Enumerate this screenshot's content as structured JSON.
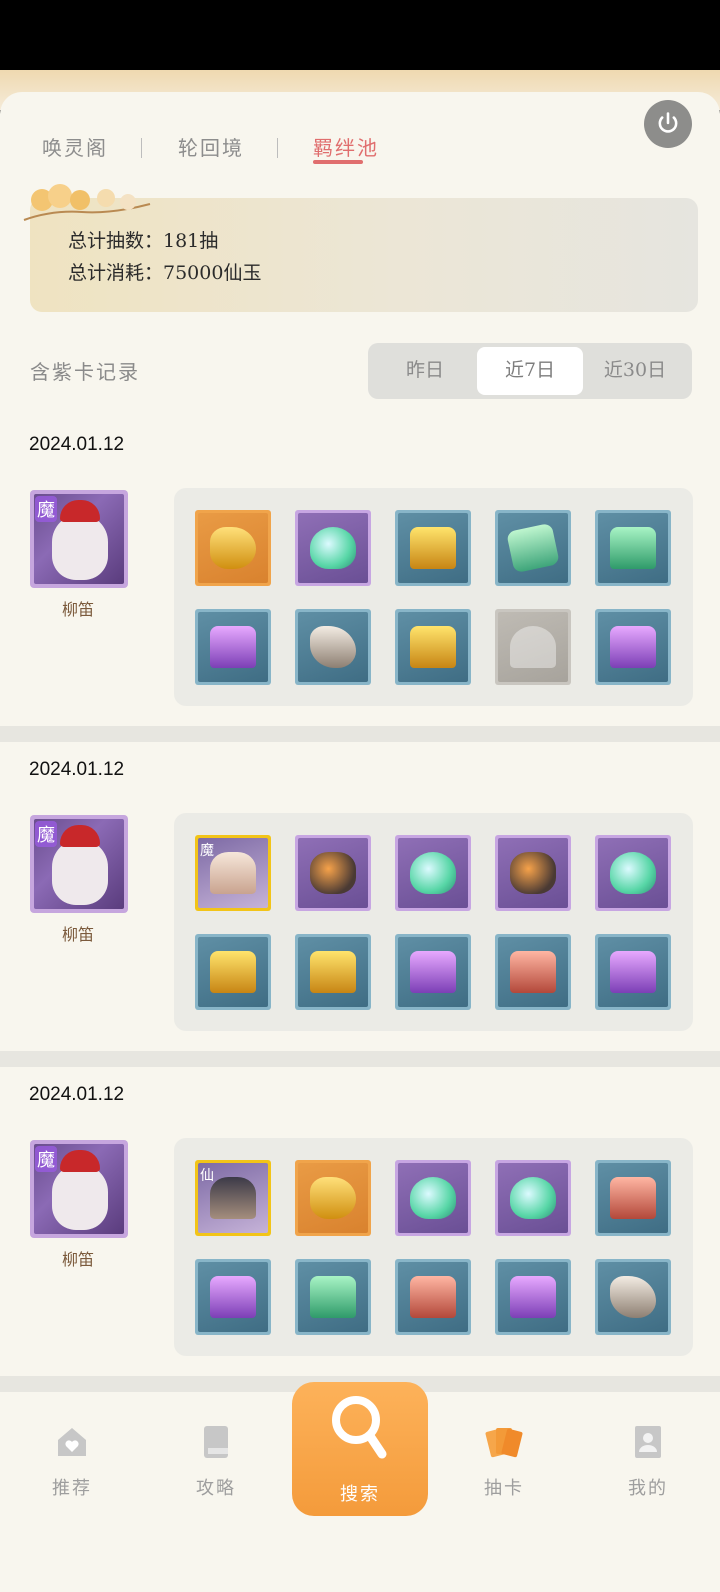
{
  "tabs": [
    {
      "label": "唤灵阁",
      "active": false
    },
    {
      "label": "轮回境",
      "active": false
    },
    {
      "label": "羁绊池",
      "active": true
    }
  ],
  "summary": {
    "total_draws": "总计抽数：181抽",
    "total_cost": "总计消耗：75000仙玉"
  },
  "records": {
    "title": "含紫卡记录",
    "ranges": [
      {
        "label": "昨日",
        "active": false
      },
      {
        "label": "近7日",
        "active": true
      },
      {
        "label": "近30日",
        "active": false
      }
    ]
  },
  "groups": [
    {
      "date": "2024.01.12",
      "character": {
        "name": "柳笛",
        "badge": "魔"
      },
      "items": [
        {
          "frame": "orange",
          "icon": "shard"
        },
        {
          "frame": "purple",
          "icon": "gem"
        },
        {
          "frame": "blue",
          "icon": "chest-gold"
        },
        {
          "frame": "blue",
          "icon": "leaf"
        },
        {
          "frame": "blue",
          "icon": "chest-green"
        },
        {
          "frame": "blue",
          "icon": "chest-purple"
        },
        {
          "frame": "blue",
          "icon": "stone"
        },
        {
          "frame": "blue",
          "icon": "chest-gold"
        },
        {
          "frame": "grey",
          "icon": "ghost"
        },
        {
          "frame": "blue",
          "icon": "chest-purple"
        }
      ]
    },
    {
      "date": "2024.01.12",
      "character": {
        "name": "柳笛",
        "badge": "魔"
      },
      "items": [
        {
          "frame": "char",
          "icon": "portrait",
          "badge": "魔"
        },
        {
          "frame": "purple",
          "icon": "ember"
        },
        {
          "frame": "purple",
          "icon": "gem"
        },
        {
          "frame": "purple",
          "icon": "ember"
        },
        {
          "frame": "purple",
          "icon": "gem"
        },
        {
          "frame": "blue",
          "icon": "chest-gold"
        },
        {
          "frame": "blue",
          "icon": "chest-gold"
        },
        {
          "frame": "blue",
          "icon": "chest-purple"
        },
        {
          "frame": "blue",
          "icon": "chest-red"
        },
        {
          "frame": "blue",
          "icon": "chest-purple"
        }
      ]
    },
    {
      "date": "2024.01.12",
      "character": {
        "name": "柳笛",
        "badge": "魔"
      },
      "items": [
        {
          "frame": "char",
          "icon": "portrait-dark",
          "badge": "仙"
        },
        {
          "frame": "orange",
          "icon": "shard"
        },
        {
          "frame": "purple",
          "icon": "gem"
        },
        {
          "frame": "purple",
          "icon": "gem"
        },
        {
          "frame": "blue",
          "icon": "chest-red"
        },
        {
          "frame": "blue",
          "icon": "chest-purple"
        },
        {
          "frame": "blue",
          "icon": "chest-green"
        },
        {
          "frame": "blue",
          "icon": "chest-red"
        },
        {
          "frame": "blue",
          "icon": "chest-purple"
        },
        {
          "frame": "blue",
          "icon": "stone"
        }
      ]
    }
  ],
  "nav": [
    {
      "label": "推荐",
      "icon": "home-icon",
      "active": false
    },
    {
      "label": "攻略",
      "icon": "book-icon",
      "active": false
    },
    {
      "label": "搜索",
      "icon": "search-icon",
      "active": false
    },
    {
      "label": "抽卡",
      "icon": "cards-icon",
      "active": true
    },
    {
      "label": "我的",
      "icon": "profile-icon",
      "active": false
    }
  ],
  "colors": {
    "accent_red": "#e06e6e",
    "accent_orange": "#f29c33",
    "rarity_orange": "#f0a44b",
    "rarity_purple": "#c7a6e2",
    "rarity_blue": "#88b5c8"
  }
}
